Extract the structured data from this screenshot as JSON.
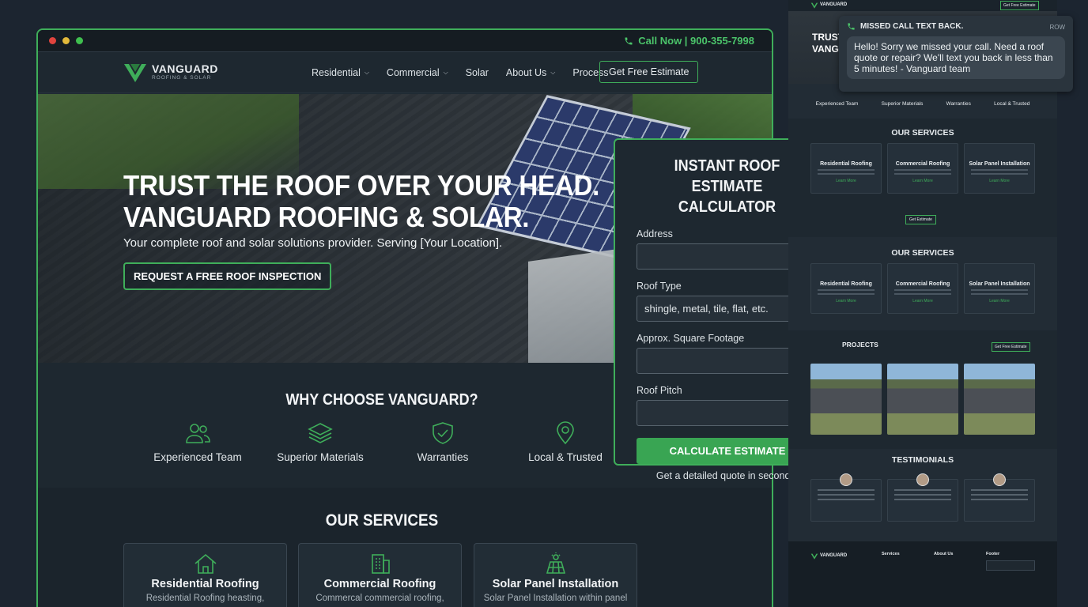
{
  "window": {
    "call_now": "Call Now | 900-355-7998"
  },
  "brand": {
    "name": "VANGUARD",
    "tagline": "ROOFING & SOLAR",
    "accent_color": "#3fae5a"
  },
  "nav": {
    "items": [
      {
        "label": "Residential",
        "dropdown": true
      },
      {
        "label": "Commercial",
        "dropdown": true
      },
      {
        "label": "Solar",
        "dropdown": false
      },
      {
        "label": "About Us",
        "dropdown": true
      },
      {
        "label": "Process",
        "dropdown": false
      }
    ],
    "cta": "Get Free Estimate"
  },
  "hero": {
    "headline_1": "TRUST THE ROOF OVER YOUR HEAD.",
    "headline_2": "VANGUARD ROOFING & SOLAR.",
    "subtitle": "Your complete roof and solar solutions provider. Serving [Your Location].",
    "cta": "REQUEST A FREE ROOF INSPECTION"
  },
  "why": {
    "title": "WHY CHOOSE VANGUARD?",
    "features": [
      {
        "label": "Experienced Team",
        "icon": "users-icon"
      },
      {
        "label": "Superior Materials",
        "icon": "layers-icon"
      },
      {
        "label": "Warranties",
        "icon": "shield-check-icon"
      },
      {
        "label": "Local & Trusted",
        "icon": "map-pin-icon"
      }
    ]
  },
  "services": {
    "title": "OUR SERVICES",
    "items": [
      {
        "title": "Residential Roofing",
        "desc": "Residential Roofing heasting,",
        "icon": "house-icon"
      },
      {
        "title": "Commercial Roofing",
        "desc": "Commercal commercial roofing,",
        "icon": "building-icon"
      },
      {
        "title": "Solar Panel Installation",
        "desc": "Solar Panel Installation within panel",
        "icon": "solar-panel-icon"
      }
    ]
  },
  "calculator": {
    "title_1": "INSTANT ROOF ESTIMATE",
    "title_2": "CALCULATOR",
    "address_label": "Address",
    "address_value": "",
    "roof_type_label": "Roof Type",
    "roof_type_value": "shingle, metal, tile, flat, etc.",
    "sqft_label": "Approx. Square Footage",
    "sqft_value": "",
    "pitch_label": "Roof Pitch",
    "pitch_value": "",
    "button": "CALCULATE ESTIMATE",
    "note": "Get a detailed quote in seconds."
  },
  "notification": {
    "title": "MISSED CALL TEXT BACK.",
    "time": "ROW",
    "message": "Hello! Sorry we missed your call. Need a roof quote or repair? We'll text you back in less than 5 minutes! - Vanguard team"
  },
  "preview": {
    "nav_cta": "Get Free Estimate",
    "hero_title_1": "TRUST",
    "hero_title_2": "VANG",
    "features": [
      "Experienced Team",
      "Superior Materials",
      "Warranties",
      "Local & Trusted"
    ],
    "services_title": "OUR SERVICES",
    "service_cards": [
      "Residential Roofing",
      "Commercial Roofing",
      "Solar Panel Installation"
    ],
    "service_link": "Learn More",
    "get_estimate": "Get Estimate",
    "services_title_2": "OUR SERVICES",
    "projects_title": "PROJECTS",
    "projects_cta": "Get Free Estimate",
    "testimonials_title": "TESTIMONIALS",
    "footer_cols": [
      "Services",
      "About Us",
      "Footer"
    ]
  }
}
